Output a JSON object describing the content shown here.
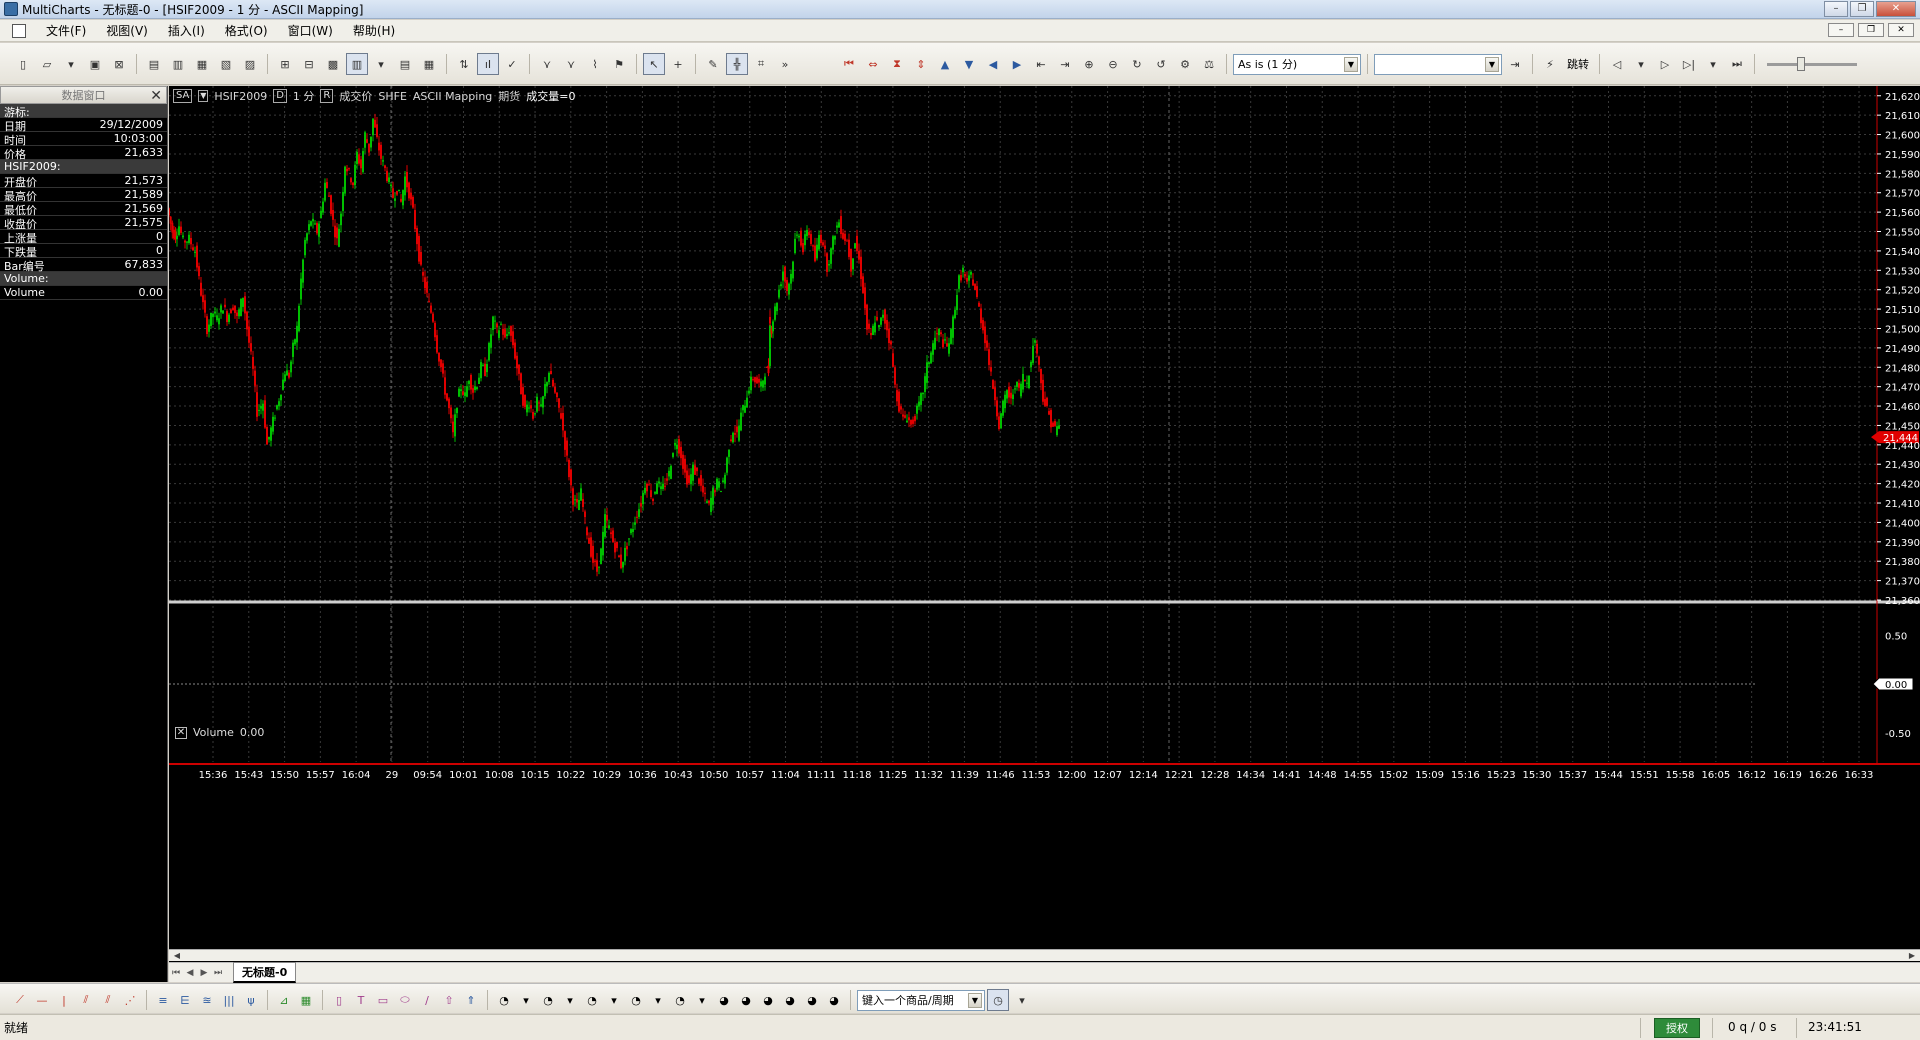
{
  "window": {
    "title": "MultiCharts - 无标题-0 - [HSIF2009 - 1 分 - ASCII Mapping]"
  },
  "menu": {
    "items": [
      "文件(F)",
      "视图(V)",
      "插入(I)",
      "格式(O)",
      "窗口(W)",
      "帮助(H)"
    ]
  },
  "toolbar": {
    "resolution": "As is (1 分)",
    "jump_label": "跳转",
    "symbol_box": ""
  },
  "data_window": {
    "title": "数据窗口",
    "cursor_section": "游标:",
    "rows_cursor": [
      {
        "label": "日期",
        "value": "29/12/2009"
      },
      {
        "label": "时间",
        "value": "10:03:00"
      },
      {
        "label": "价格",
        "value": "21,633"
      }
    ],
    "symbol_section": "HSIF2009:",
    "rows_symbol": [
      {
        "label": "开盘价",
        "value": "21,573"
      },
      {
        "label": "最高价",
        "value": "21,589"
      },
      {
        "label": "最低价",
        "value": "21,569"
      },
      {
        "label": "收盘价",
        "value": "21,575"
      },
      {
        "label": "上涨量",
        "value": "0"
      },
      {
        "label": "下跌量",
        "value": "0"
      },
      {
        "label": "Bar编号",
        "value": "67,833"
      }
    ],
    "volume_section": "Volume:",
    "rows_volume": [
      {
        "label": "Volume",
        "value": "0.00"
      }
    ]
  },
  "chart_legend": {
    "sa": "SA",
    "symbol": "HSIF2009",
    "d_label": "D",
    "interval": "1 分",
    "r_label": "R",
    "price_type": "成交价",
    "exchange": "SHFE",
    "datasource": "ASCII Mapping",
    "category": "期货",
    "volume_text": "成交量=0"
  },
  "volume_legend": {
    "name": "Volume",
    "value": "0.00"
  },
  "chart_data": {
    "type": "candlestick",
    "symbol": "HSIF2009",
    "price_axis": {
      "ticks": [
        "21,620",
        "21,610",
        "21,600",
        "21,590",
        "21,580",
        "21,570",
        "21,560",
        "21,550",
        "21,540",
        "21,530",
        "21,520",
        "21,510",
        "21,500",
        "21,490",
        "21,480",
        "21,470",
        "21,460",
        "21,450",
        "21,444",
        "21,440",
        "21,430",
        "21,420",
        "21,410",
        "21,400",
        "21,390",
        "21,380",
        "21,370",
        "21,360"
      ],
      "ylim": [
        21360,
        21624
      ],
      "last_price_label": "21,444"
    },
    "volume_axis": {
      "ticks": [
        "0.50",
        "0.00",
        "-0.50"
      ],
      "current_label": "0.00",
      "ylim": [
        -0.8,
        0.8
      ]
    },
    "x_ticks": [
      "15:36",
      "15:43",
      "15:50",
      "15:57",
      "16:04",
      "29",
      "09:54",
      "10:01",
      "10:08",
      "10:15",
      "10:22",
      "10:29",
      "10:36",
      "10:43",
      "10:50",
      "10:57",
      "11:04",
      "11:11",
      "11:18",
      "11:25",
      "11:32",
      "11:39",
      "11:46",
      "11:53",
      "12:00",
      "12:07",
      "12:14",
      "12:21",
      "12:28",
      "14:34",
      "14:41",
      "14:48",
      "14:55",
      "15:02",
      "15:09",
      "15:16",
      "15:23",
      "15:30",
      "15:37",
      "15:44",
      "15:51",
      "15:58",
      "16:05",
      "16:12",
      "16:19",
      "16:26",
      "16:33"
    ],
    "colors": {
      "up": "#00c000",
      "down": "#e00000",
      "grid": "#3a3a3a",
      "background": "#000000",
      "axis_text": "#ffffff",
      "last_price": "#e00000"
    },
    "series_path": [
      [
        0,
        21562
      ],
      [
        5,
        21550
      ],
      [
        8,
        21548
      ],
      [
        12,
        21553
      ],
      [
        16,
        21545
      ],
      [
        22,
        21546
      ],
      [
        28,
        21540
      ],
      [
        32,
        21525
      ],
      [
        36,
        21512
      ],
      [
        40,
        21500
      ],
      [
        46,
        21508
      ],
      [
        50,
        21505
      ],
      [
        56,
        21512
      ],
      [
        60,
        21506
      ],
      [
        66,
        21512
      ],
      [
        70,
        21505
      ],
      [
        76,
        21517
      ],
      [
        80,
        21500
      ],
      [
        86,
        21478
      ],
      [
        90,
        21457
      ],
      [
        96,
        21462
      ],
      [
        100,
        21440
      ],
      [
        104,
        21448
      ],
      [
        108,
        21456
      ],
      [
        112,
        21464
      ],
      [
        118,
        21478
      ],
      [
        122,
        21476
      ],
      [
        126,
        21490
      ],
      [
        130,
        21500
      ],
      [
        134,
        21525
      ],
      [
        138,
        21545
      ],
      [
        144,
        21556
      ],
      [
        150,
        21550
      ],
      [
        154,
        21560
      ],
      [
        158,
        21575
      ],
      [
        162,
        21568
      ],
      [
        166,
        21555
      ],
      [
        170,
        21545
      ],
      [
        174,
        21560
      ],
      [
        178,
        21585
      ],
      [
        182,
        21580
      ],
      [
        186,
        21575
      ],
      [
        190,
        21590
      ],
      [
        194,
        21583
      ],
      [
        198,
        21600
      ],
      [
        202,
        21592
      ],
      [
        206,
        21608
      ],
      [
        210,
        21597
      ],
      [
        214,
        21588
      ],
      [
        218,
        21582
      ],
      [
        222,
        21575
      ],
      [
        226,
        21568
      ],
      [
        230,
        21572
      ],
      [
        234,
        21565
      ],
      [
        238,
        21578
      ],
      [
        242,
        21570
      ],
      [
        246,
        21560
      ],
      [
        250,
        21545
      ],
      [
        254,
        21530
      ],
      [
        258,
        21522
      ],
      [
        262,
        21512
      ],
      [
        266,
        21505
      ],
      [
        270,
        21490
      ],
      [
        274,
        21480
      ],
      [
        278,
        21468
      ],
      [
        282,
        21458
      ],
      [
        286,
        21445
      ],
      [
        290,
        21462
      ],
      [
        294,
        21470
      ],
      [
        298,
        21465
      ],
      [
        302,
        21475
      ],
      [
        306,
        21468
      ],
      [
        310,
        21472
      ],
      [
        314,
        21480
      ],
      [
        318,
        21478
      ],
      [
        322,
        21490
      ],
      [
        326,
        21505
      ],
      [
        330,
        21498
      ],
      [
        334,
        21502
      ],
      [
        338,
        21494
      ],
      [
        342,
        21500
      ],
      [
        346,
        21492
      ],
      [
        350,
        21480
      ],
      [
        354,
        21468
      ],
      [
        358,
        21458
      ],
      [
        362,
        21462
      ],
      [
        366,
        21455
      ],
      [
        370,
        21462
      ],
      [
        374,
        21458
      ],
      [
        378,
        21470
      ],
      [
        382,
        21478
      ],
      [
        386,
        21470
      ],
      [
        390,
        21462
      ],
      [
        394,
        21455
      ],
      [
        398,
        21440
      ],
      [
        402,
        21425
      ],
      [
        406,
        21412
      ],
      [
        410,
        21408
      ],
      [
        414,
        21415
      ],
      [
        418,
        21400
      ],
      [
        422,
        21390
      ],
      [
        426,
        21380
      ],
      [
        430,
        21375
      ],
      [
        434,
        21385
      ],
      [
        438,
        21402
      ],
      [
        442,
        21397
      ],
      [
        446,
        21390
      ],
      [
        450,
        21385
      ],
      [
        454,
        21378
      ],
      [
        458,
        21385
      ],
      [
        462,
        21392
      ],
      [
        466,
        21398
      ],
      [
        470,
        21405
      ],
      [
        474,
        21410
      ],
      [
        478,
        21420
      ],
      [
        482,
        21418
      ],
      [
        486,
        21412
      ],
      [
        490,
        21422
      ],
      [
        494,
        21416
      ],
      [
        498,
        21420
      ],
      [
        502,
        21425
      ],
      [
        506,
        21438
      ],
      [
        510,
        21442
      ],
      [
        514,
        21435
      ],
      [
        518,
        21425
      ],
      [
        522,
        21420
      ],
      [
        526,
        21428
      ],
      [
        530,
        21425
      ],
      [
        534,
        21418
      ],
      [
        538,
        21412
      ],
      [
        542,
        21408
      ],
      [
        546,
        21416
      ],
      [
        550,
        21420
      ],
      [
        554,
        21418
      ],
      [
        558,
        21425
      ],
      [
        562,
        21440
      ],
      [
        566,
        21448
      ],
      [
        570,
        21445
      ],
      [
        574,
        21455
      ],
      [
        578,
        21462
      ],
      [
        582,
        21470
      ],
      [
        586,
        21475
      ],
      [
        590,
        21472
      ],
      [
        594,
        21470
      ],
      [
        598,
        21478
      ],
      [
        601,
        21478
      ],
      [
        601,
        21505
      ],
      [
        604,
        21500
      ],
      [
        608,
        21510
      ],
      [
        612,
        21520
      ],
      [
        616,
        21530
      ],
      [
        620,
        21520
      ],
      [
        624,
        21528
      ],
      [
        628,
        21545
      ],
      [
        632,
        21550
      ],
      [
        636,
        21540
      ],
      [
        640,
        21552
      ],
      [
        644,
        21545
      ],
      [
        648,
        21535
      ],
      [
        652,
        21548
      ],
      [
        656,
        21545
      ],
      [
        660,
        21532
      ],
      [
        664,
        21540
      ],
      [
        668,
        21550
      ],
      [
        672,
        21555
      ],
      [
        676,
        21548
      ],
      [
        680,
        21545
      ],
      [
        684,
        21532
      ],
      [
        688,
        21545
      ],
      [
        692,
        21535
      ],
      [
        696,
        21520
      ],
      [
        700,
        21500
      ],
      [
        704,
        21495
      ],
      [
        708,
        21505
      ],
      [
        712,
        21500
      ],
      [
        716,
        21508
      ],
      [
        720,
        21500
      ],
      [
        724,
        21490
      ],
      [
        728,
        21470
      ],
      [
        732,
        21460
      ],
      [
        736,
        21453
      ],
      [
        740,
        21455
      ],
      [
        744,
        21450
      ],
      [
        748,
        21455
      ],
      [
        752,
        21460
      ],
      [
        756,
        21468
      ],
      [
        760,
        21480
      ],
      [
        764,
        21488
      ],
      [
        768,
        21495
      ],
      [
        772,
        21498
      ],
      [
        776,
        21493
      ],
      [
        780,
        21490
      ],
      [
        784,
        21497
      ],
      [
        788,
        21512
      ],
      [
        792,
        21525
      ],
      [
        796,
        21530
      ],
      [
        800,
        21522
      ],
      [
        804,
        21528
      ],
      [
        808,
        21520
      ],
      [
        812,
        21510
      ],
      [
        816,
        21500
      ],
      [
        820,
        21490
      ],
      [
        824,
        21475
      ],
      [
        828,
        21465
      ],
      [
        832,
        21450
      ],
      [
        836,
        21460
      ],
      [
        840,
        21468
      ],
      [
        844,
        21462
      ],
      [
        848,
        21472
      ],
      [
        852,
        21468
      ],
      [
        856,
        21475
      ],
      [
        860,
        21472
      ],
      [
        864,
        21485
      ],
      [
        868,
        21495
      ],
      [
        872,
        21480
      ],
      [
        876,
        21465
      ],
      [
        880,
        21458
      ],
      [
        884,
        21452
      ],
      [
        888,
        21448
      ],
      [
        892,
        21450
      ]
    ]
  },
  "tabs": {
    "active": "无标题-0"
  },
  "drawbar": {
    "symbol_input": "键入一个商品/周期"
  },
  "status": {
    "ready": "就绪",
    "auth": "授权",
    "queue": "0 q / 0 s",
    "clock": "23:41:51"
  }
}
